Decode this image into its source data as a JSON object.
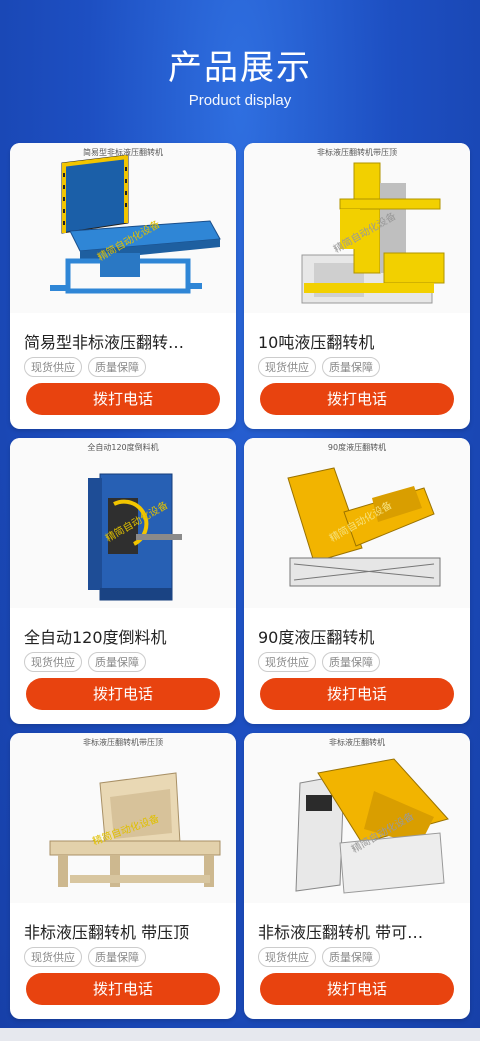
{
  "header": {
    "title": "产品展示",
    "subtitle": "Product display"
  },
  "products": [
    {
      "name": "简易型非标液压翻转…",
      "caption": "简易型非标液压翻转机",
      "tags": [
        "现货供应",
        "质量保障"
      ],
      "button": "拨打电话",
      "watermark": "精简自动化设备"
    },
    {
      "name": "10吨液压翻转机",
      "caption": "非标液压翻转机带压顶",
      "tags": [
        "现货供应",
        "质量保障"
      ],
      "button": "拨打电话",
      "watermark": "精简自动化设备"
    },
    {
      "name": "全自动120度倒料机",
      "caption": "全自动120度倒料机",
      "tags": [
        "现货供应",
        "质量保障"
      ],
      "button": "拨打电话",
      "watermark": "精简自动化设备"
    },
    {
      "name": "90度液压翻转机",
      "caption": "90度液压翻转机",
      "tags": [
        "现货供应",
        "质量保障"
      ],
      "button": "拨打电话",
      "watermark": "精简自动化设备"
    },
    {
      "name": "非标液压翻转机 带压顶",
      "caption": "非标液压翻转机带压顶",
      "tags": [
        "现货供应",
        "质量保障"
      ],
      "button": "拨打电话",
      "watermark": "精简自动化设备"
    },
    {
      "name": "非标液压翻转机 带可…",
      "caption": "非标液压翻转机",
      "tags": [
        "现货供应",
        "质量保障"
      ],
      "button": "拨打电话",
      "watermark": "精简自动化设备"
    }
  ]
}
